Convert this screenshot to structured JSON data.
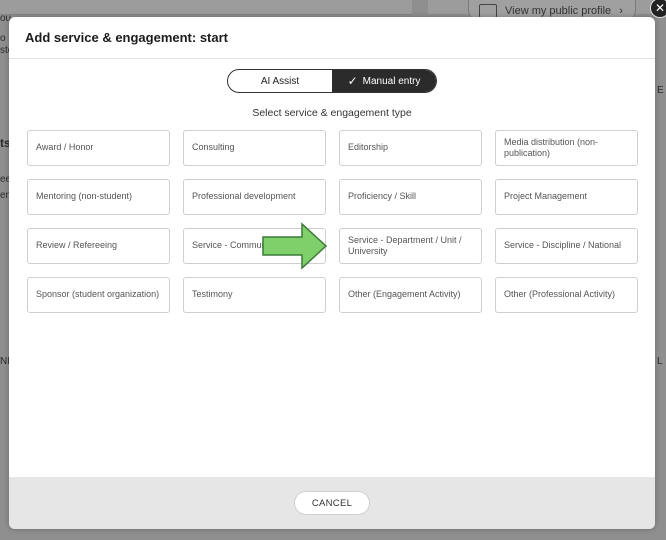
{
  "background": {
    "profile_link": "View my public profile",
    "profile_chevron": "›",
    "close_glyph": "✕",
    "fragments": [
      "ou",
      "o",
      "sto",
      "ts",
      "ee",
      "ent",
      "NI",
      "E",
      "L"
    ]
  },
  "modal": {
    "title": "Add service & engagement: start",
    "mode_toggle": {
      "ai_assist": "AI Assist",
      "manual_entry": "Manual entry",
      "check": "✓",
      "selected": "Manual entry"
    },
    "section_label": "Select service & engagement type",
    "options": [
      "Award / Honor",
      "Consulting",
      "Editorship",
      "Media distribution (non-publication)",
      "Mentoring (non-student)",
      "Professional development",
      "Proficiency / Skill",
      "Project Management",
      "Review / Refereeing",
      "Service - Community",
      "Service - Department / Unit / University",
      "Service - Discipline / National",
      "Sponsor (student organization)",
      "Testimony",
      "Other (Engagement Activity)",
      "Other (Professional Activity)"
    ],
    "cancel_label": "CANCEL"
  },
  "colors": {
    "overlay": "#8f8f8f",
    "arrow_fill": "#7fcf6a",
    "arrow_stroke": "#3f7a3a",
    "toggle_active": "#2b2b2b"
  }
}
